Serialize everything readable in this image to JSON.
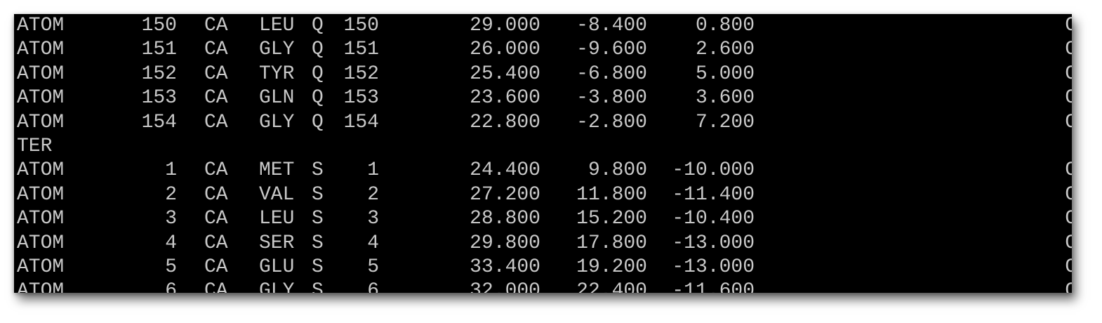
{
  "terminal": {
    "rows": [
      {
        "record": "ATOM",
        "serial": "150",
        "atom_name": "CA",
        "residue": "LEU",
        "chain": "Q",
        "res_seq": "150",
        "x": "29.000",
        "y": "-8.400",
        "z": "0.800",
        "element": "C"
      },
      {
        "record": "ATOM",
        "serial": "151",
        "atom_name": "CA",
        "residue": "GLY",
        "chain": "Q",
        "res_seq": "151",
        "x": "26.000",
        "y": "-9.600",
        "z": "2.600",
        "element": "C"
      },
      {
        "record": "ATOM",
        "serial": "152",
        "atom_name": "CA",
        "residue": "TYR",
        "chain": "Q",
        "res_seq": "152",
        "x": "25.400",
        "y": "-6.800",
        "z": "5.000",
        "element": "C"
      },
      {
        "record": "ATOM",
        "serial": "153",
        "atom_name": "CA",
        "residue": "GLN",
        "chain": "Q",
        "res_seq": "153",
        "x": "23.600",
        "y": "-3.800",
        "z": "3.600",
        "element": "C"
      },
      {
        "record": "ATOM",
        "serial": "154",
        "atom_name": "CA",
        "residue": "GLY",
        "chain": "Q",
        "res_seq": "154",
        "x": "22.800",
        "y": "-2.800",
        "z": "7.200",
        "element": "C"
      },
      {
        "record": "TER",
        "serial": "",
        "atom_name": "",
        "residue": "",
        "chain": "",
        "res_seq": "",
        "x": "",
        "y": "",
        "z": "",
        "element": ""
      },
      {
        "record": "ATOM",
        "serial": "1",
        "atom_name": "CA",
        "residue": "MET",
        "chain": "S",
        "res_seq": "1",
        "x": "24.400",
        "y": "9.800",
        "z": "-10.000",
        "element": "C"
      },
      {
        "record": "ATOM",
        "serial": "2",
        "atom_name": "CA",
        "residue": "VAL",
        "chain": "S",
        "res_seq": "2",
        "x": "27.200",
        "y": "11.800",
        "z": "-11.400",
        "element": "C"
      },
      {
        "record": "ATOM",
        "serial": "3",
        "atom_name": "CA",
        "residue": "LEU",
        "chain": "S",
        "res_seq": "3",
        "x": "28.800",
        "y": "15.200",
        "z": "-10.400",
        "element": "C"
      },
      {
        "record": "ATOM",
        "serial": "4",
        "atom_name": "CA",
        "residue": "SER",
        "chain": "S",
        "res_seq": "4",
        "x": "29.800",
        "y": "17.800",
        "z": "-13.000",
        "element": "C"
      },
      {
        "record": "ATOM",
        "serial": "5",
        "atom_name": "CA",
        "residue": "GLU",
        "chain": "S",
        "res_seq": "5",
        "x": "33.400",
        "y": "19.200",
        "z": "-13.000",
        "element": "C"
      },
      {
        "record": "ATOM",
        "serial": "6",
        "atom_name": "CA",
        "residue": "GLY",
        "chain": "S",
        "res_seq": "6",
        "x": "32.000",
        "y": "22.400",
        "z": "-11.600",
        "element": "C"
      }
    ]
  }
}
